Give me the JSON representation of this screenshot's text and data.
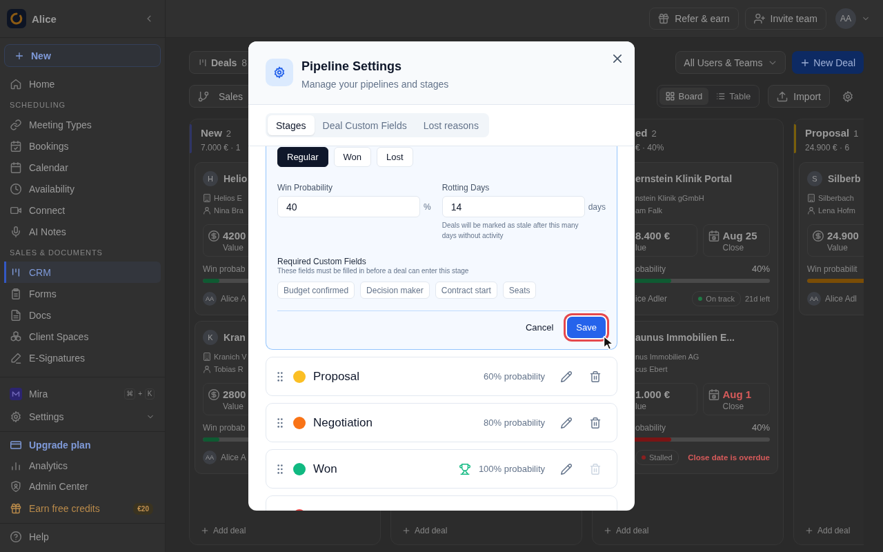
{
  "sidebar": {
    "workspace": "Alice",
    "new_button": "New",
    "nav": [
      {
        "kind": "link",
        "label": "Home",
        "selected": false
      },
      {
        "kind": "section",
        "label": "SCHEDULING"
      },
      {
        "kind": "link",
        "label": "Meeting Types",
        "selected": false
      },
      {
        "kind": "link",
        "label": "Bookings",
        "selected": false
      },
      {
        "kind": "link",
        "label": "Calendar",
        "selected": false
      },
      {
        "kind": "link",
        "label": "Availability",
        "selected": false
      },
      {
        "kind": "link",
        "label": "Connect",
        "selected": false
      },
      {
        "kind": "link",
        "label": "AI Notes",
        "selected": false
      },
      {
        "kind": "section",
        "label": "SALES & DOCUMENTS"
      },
      {
        "kind": "link",
        "label": "CRM",
        "selected": true
      },
      {
        "kind": "link",
        "label": "Forms",
        "selected": false
      },
      {
        "kind": "link",
        "label": "Docs",
        "selected": false
      },
      {
        "kind": "link",
        "label": "Client Spaces",
        "selected": false
      },
      {
        "kind": "link",
        "label": "E-Signatures",
        "selected": false
      }
    ],
    "assistant": {
      "label": "Mira",
      "shortcut": [
        {
          "kind": "key",
          "label": "⌘"
        },
        {
          "kind": "separator",
          "label": "+"
        },
        {
          "kind": "key",
          "label": "K"
        }
      ]
    },
    "settings": {
      "label": "Settings",
      "expanded": false
    },
    "footer": [
      {
        "kind": "upgrade",
        "label": "Upgrade plan"
      },
      {
        "kind": "link",
        "label": "Analytics"
      },
      {
        "kind": "link",
        "label": "Admin Center"
      },
      {
        "kind": "reward",
        "label": "Earn free credits",
        "badge": "€20"
      }
    ],
    "help": "Help"
  },
  "topbar": {
    "buttons": [
      "Refer & earn",
      "Invite team"
    ],
    "avatar": "AA"
  },
  "board": {
    "title": "Deals",
    "count": "8",
    "pipeline": "Sales",
    "owner_filter": "All Users & Teams",
    "new_deal": "New Deal",
    "views": [
      {
        "label": "Board",
        "selected": true
      },
      {
        "label": "Table",
        "selected": false
      }
    ],
    "import": "Import",
    "columns": [
      {
        "name": "New",
        "count": "2",
        "summary": "7.000 € · 1",
        "color": "#2f3566",
        "cards": [
          {
            "initial": "H",
            "title": "Helio",
            "company": "Helios E",
            "contact": "Nina Bra",
            "value": "4200",
            "value_label": "Value",
            "probability_label": "Win probab",
            "progress": {
              "level": 0.1,
              "color": "#0f5a32"
            },
            "owner_initials": "AA",
            "owner": "Alice A"
          },
          {
            "initial": "K",
            "title": "Kran",
            "company": "Kranich V",
            "contact": "Tobias R",
            "value": "2800",
            "value_label": "Value",
            "probability_label": "Win probab",
            "progress": {
              "level": 0.1,
              "color": "#0f5a32"
            },
            "owner_initials": "AA",
            "owner": "Alice A"
          }
        ],
        "add_label": "Add deal"
      },
      {
        "add_label": "Add deal"
      },
      {
        "name": "ed",
        "count": "2",
        "summary": "€ · 40%",
        "cards": [
          {
            "title": "ernstein Klinik Portal",
            "company": "nstein Klinik gGmbH",
            "contact": "am Falk",
            "value": "8.400 €",
            "value_label": "lue",
            "close": {
              "date": "Aug 25",
              "label": "Close",
              "overdue": false
            },
            "probability_label": "obability",
            "probability": "40%",
            "progress": {
              "level": 0.4,
              "color": "#0f5a32"
            },
            "owner": "ice Adler",
            "status": {
              "label": "On track",
              "color": "#1f7a45"
            },
            "due": "21d left"
          },
          {
            "title": "aunus Immobilien E...",
            "company": "nus Immobilien AG",
            "contact": "cus Ebert",
            "value": "1.000 €",
            "value_label": "lue",
            "close": {
              "date": "Aug 1",
              "label": "Close",
              "overdue": true
            },
            "probability_label": "obability",
            "probability": "40%",
            "progress": {
              "level": 0.4,
              "color": "#7a1414"
            },
            "status": {
              "label": "Stalled",
              "color": "#8a2020"
            },
            "alert": "Close date is overdue"
          }
        ],
        "add_label": "Add deal"
      },
      {
        "name": "Proposal",
        "count": "1",
        "summary": "24.900 € · 6",
        "color": "#7a5f0a",
        "cards": [
          {
            "initial": "S",
            "title": "Silberb",
            "company": "Silberbach",
            "contact": "Lena Hofm",
            "value": "24.900",
            "value_label": "Value",
            "probability_label": "Win probabilit",
            "progress": {
              "level": 0.6,
              "color": "#7a4d06"
            },
            "owner_initials": "AA",
            "owner": "Alice Adl"
          }
        ],
        "add_label": "Add deal"
      }
    ]
  },
  "modal": {
    "title": "Pipeline Settings",
    "subtitle": "Manage your pipelines and stages",
    "tabs": [
      {
        "label": "Stages",
        "selected": true
      },
      {
        "label": "Deal Custom Fields",
        "selected": false
      },
      {
        "label": "Lost reasons",
        "selected": false
      }
    ],
    "stage_editor": {
      "types": [
        {
          "label": "Regular",
          "selected": true
        },
        {
          "label": "Won",
          "selected": false
        },
        {
          "label": "Lost",
          "selected": false
        }
      ],
      "fields": [
        {
          "label": "Win Probability",
          "value": "40",
          "unit": "%"
        },
        {
          "label": "Rotting Days",
          "value": "14",
          "unit": "days",
          "help": "Deals will be marked as stale after this many days without activity"
        }
      ],
      "required_fields": {
        "title": "Required Custom Fields",
        "description": "These fields must be filled in before a deal can enter this stage",
        "chips": [
          "Budget confirmed",
          "Decision maker",
          "Contract start",
          "Seats"
        ]
      },
      "cancel": "Cancel",
      "save": {
        "label": "Save",
        "highlighted": true
      }
    },
    "stages": [
      {
        "name": "Proposal",
        "color": "#fbbf24",
        "kind": "regular",
        "probability": "60% probability",
        "deletable": true
      },
      {
        "name": "Negotiation",
        "color": "#f97316",
        "kind": "regular",
        "probability": "80% probability",
        "deletable": true
      },
      {
        "name": "Won",
        "color": "#10b981",
        "kind": "won",
        "probability": "100% probability",
        "deletable": false
      },
      {
        "color": "#ef4444"
      }
    ]
  }
}
